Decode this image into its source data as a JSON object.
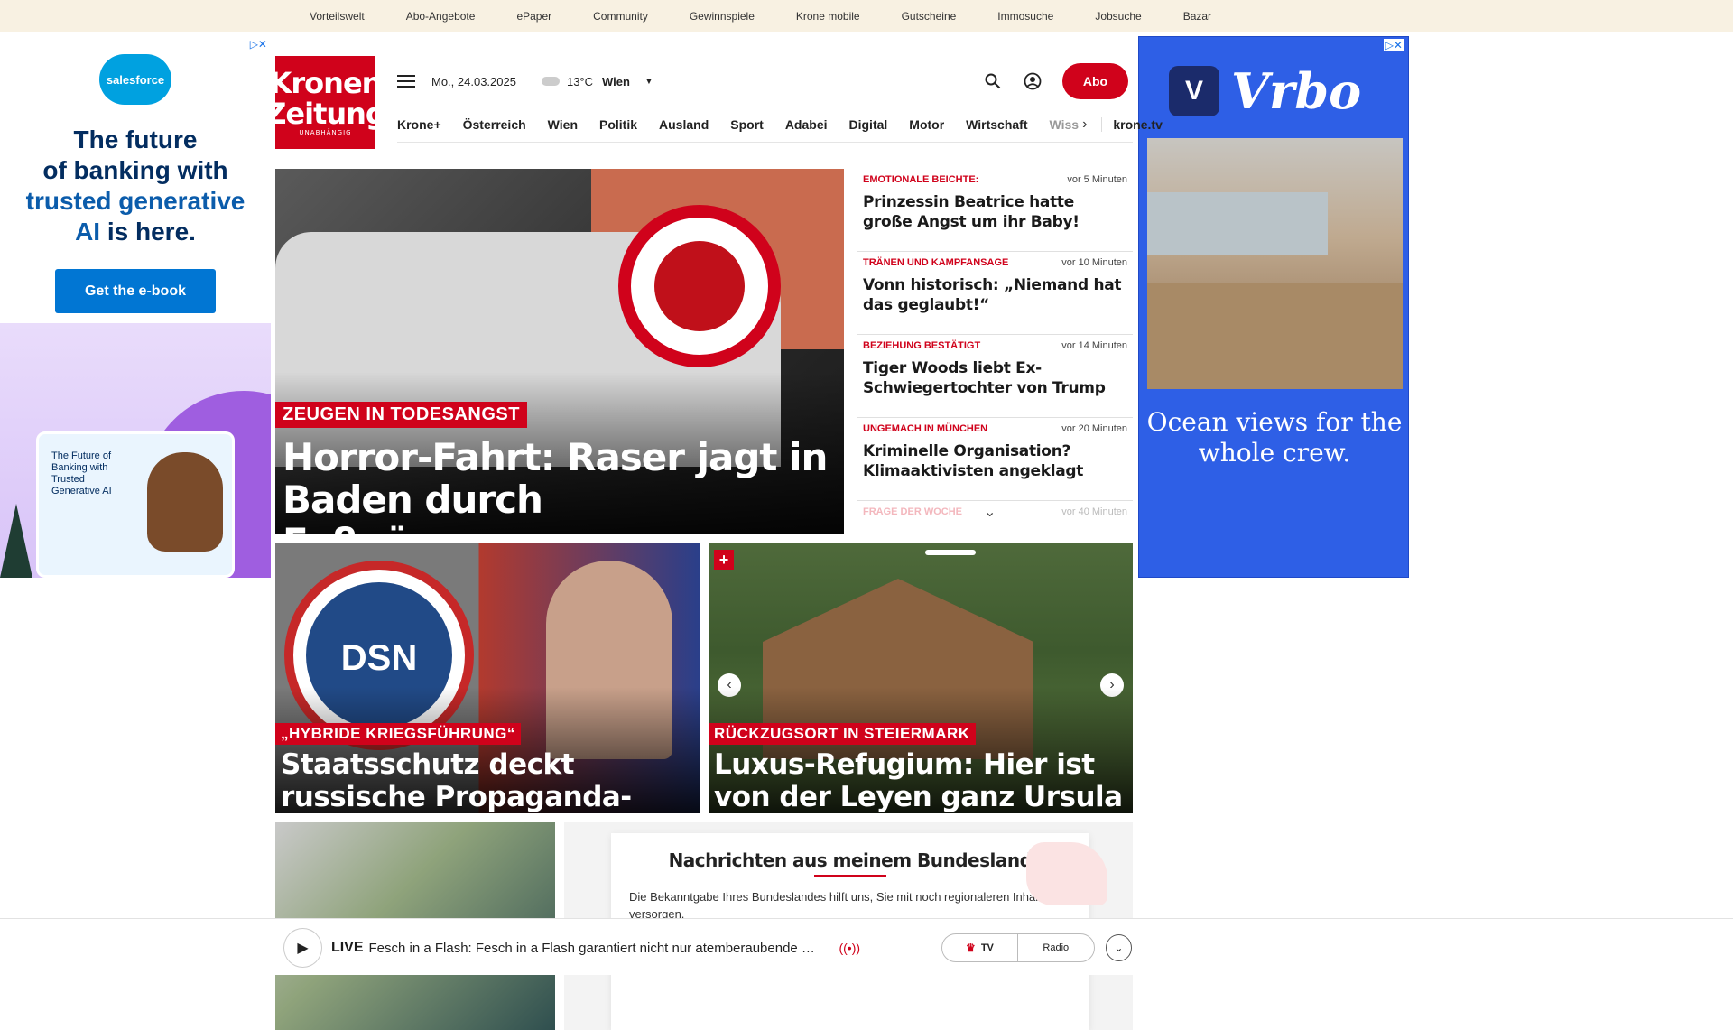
{
  "topbar": {
    "links": [
      "Vorteilswelt",
      "Abo-Angebote",
      "ePaper",
      "Community",
      "Gewinnspiele",
      "Krone mobile",
      "Gutscheine",
      "Immosuche",
      "Jobsuche",
      "Bazar"
    ]
  },
  "ad_left": {
    "brand": "salesforce",
    "headline_1": "The future",
    "headline_2": "of banking with",
    "headline_3": "trusted generative",
    "headline_4": "AI",
    "headline_5": "is here.",
    "cta": "Get the e-book",
    "card_text": "The Future of Banking with Trusted Generative AI"
  },
  "ad_right": {
    "brand": "Vrbo",
    "tagline": "Ocean views for the whole crew."
  },
  "header": {
    "logo_line1": "Kronen",
    "logo_line2": "Zeitung",
    "logo_sub": "UNABHÄNGIG",
    "date": "Mo., 24.03.2025",
    "temperature": "13°C",
    "city": "Wien",
    "abo_label": "Abo"
  },
  "nav": {
    "items": [
      "Krone+",
      "Österreich",
      "Wien",
      "Politik",
      "Ausland",
      "Sport",
      "Adabei",
      "Digital",
      "Motor",
      "Wirtschaft"
    ],
    "faded_item": "Wiss",
    "tv_link": "krone.tv"
  },
  "hero": {
    "kicker": "ZEUGEN IN TODESANGST",
    "title": "Horror-Fahrt: Raser jagt in Baden durch Fußgängerzone"
  },
  "ticker": [
    {
      "kicker": "EMOTIONALE BEICHTE:",
      "time": "vor 5 Minuten",
      "headline": "Prinzessin Beatrice hatte große Angst um ihr Baby!"
    },
    {
      "kicker": "TRÄNEN UND KAMPFANSAGE",
      "time": "vor 10 Minuten",
      "headline": "Vonn historisch: „Niemand hat das geglaubt!“"
    },
    {
      "kicker": "BEZIEHUNG BESTÄTIGT",
      "time": "vor 14 Minuten",
      "headline": "Tiger Woods liebt Ex-Schwiegertochter von Trump"
    },
    {
      "kicker": "UNGEMACH IN MÜNCHEN",
      "time": "vor 20 Minuten",
      "headline": "Kriminelle Organisation? Klimaaktivisten angeklagt"
    },
    {
      "kicker": "FRAGE DER WOCHE",
      "time": "vor 40 Minuten",
      "headline": ""
    }
  ],
  "card_left": {
    "kicker": "„HYBRIDE KRIEGSFÜHRUNG“",
    "title": "Staatsschutz deckt russische Propaganda-Operation auf",
    "seal_text": "DSN"
  },
  "card_right": {
    "kicker": "RÜCKZUGSORT IN STEIERMARK",
    "title": "Luxus-Refugium: Hier ist von der Leyen ganz Ursula"
  },
  "bundesland": {
    "heading": "Nachrichten aus meinem Bundesland",
    "text": "Die Bekanntgabe Ihres Bundeslandes hilft uns, Sie mit noch regionaleren Inhalten zu versorgen."
  },
  "player": {
    "live_label": "LIVE",
    "title": "Fesch in a Flash: Fesch in a Flash garantiert nicht nur atemberaubende …",
    "tv_label": "TV",
    "radio_label": "Radio"
  }
}
